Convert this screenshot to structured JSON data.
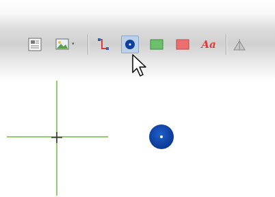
{
  "toolbar": {
    "buttons": [
      {
        "name": "page-layout-icon"
      },
      {
        "name": "image-insert-icon",
        "has_dropdown": true
      },
      {
        "name": "connector-line-icon"
      },
      {
        "name": "point-tool-icon",
        "active": true
      },
      {
        "name": "green-rectangle-icon"
      },
      {
        "name": "red-rectangle-icon"
      },
      {
        "name": "text-tool-icon",
        "label": "Aa"
      },
      {
        "name": "mountain-icon"
      }
    ],
    "dropdown_glyph": "▾"
  },
  "colors": {
    "accent_blue": "#0d3f9e",
    "crosshair_green": "#8fd06a",
    "text_red": "#e23a3a",
    "rect_green": "#6cc06c",
    "rect_red": "#ec6f6f",
    "connector_red": "#d93a3a"
  }
}
